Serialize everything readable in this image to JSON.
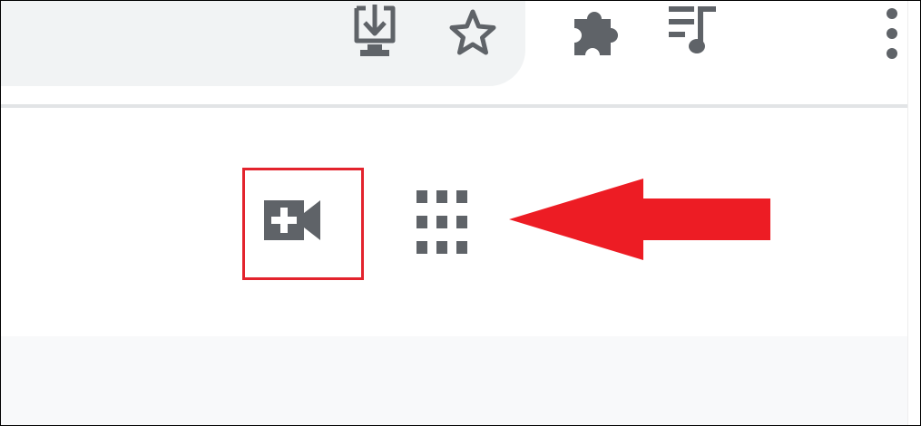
{
  "theme": {
    "icon_color": "#5f6368",
    "annotation_color": "#e3232d",
    "omnibox_bg": "#f1f3f4",
    "page_bg": "#f8f9fa"
  },
  "toolbar": {
    "icons": [
      {
        "name": "install-app-icon"
      },
      {
        "name": "bookmark-star-icon"
      },
      {
        "name": "extensions-puzzle-icon"
      },
      {
        "name": "media-controls-icon"
      },
      {
        "name": "more-menu-icon"
      }
    ]
  },
  "header": {
    "buttons": [
      {
        "name": "new-meeting-video-icon"
      },
      {
        "name": "google-apps-grid-icon"
      }
    ]
  },
  "annotation": {
    "type": "highlight-and-arrow",
    "highlighted": "new-meeting-video-icon",
    "arrow_direction": "left"
  }
}
